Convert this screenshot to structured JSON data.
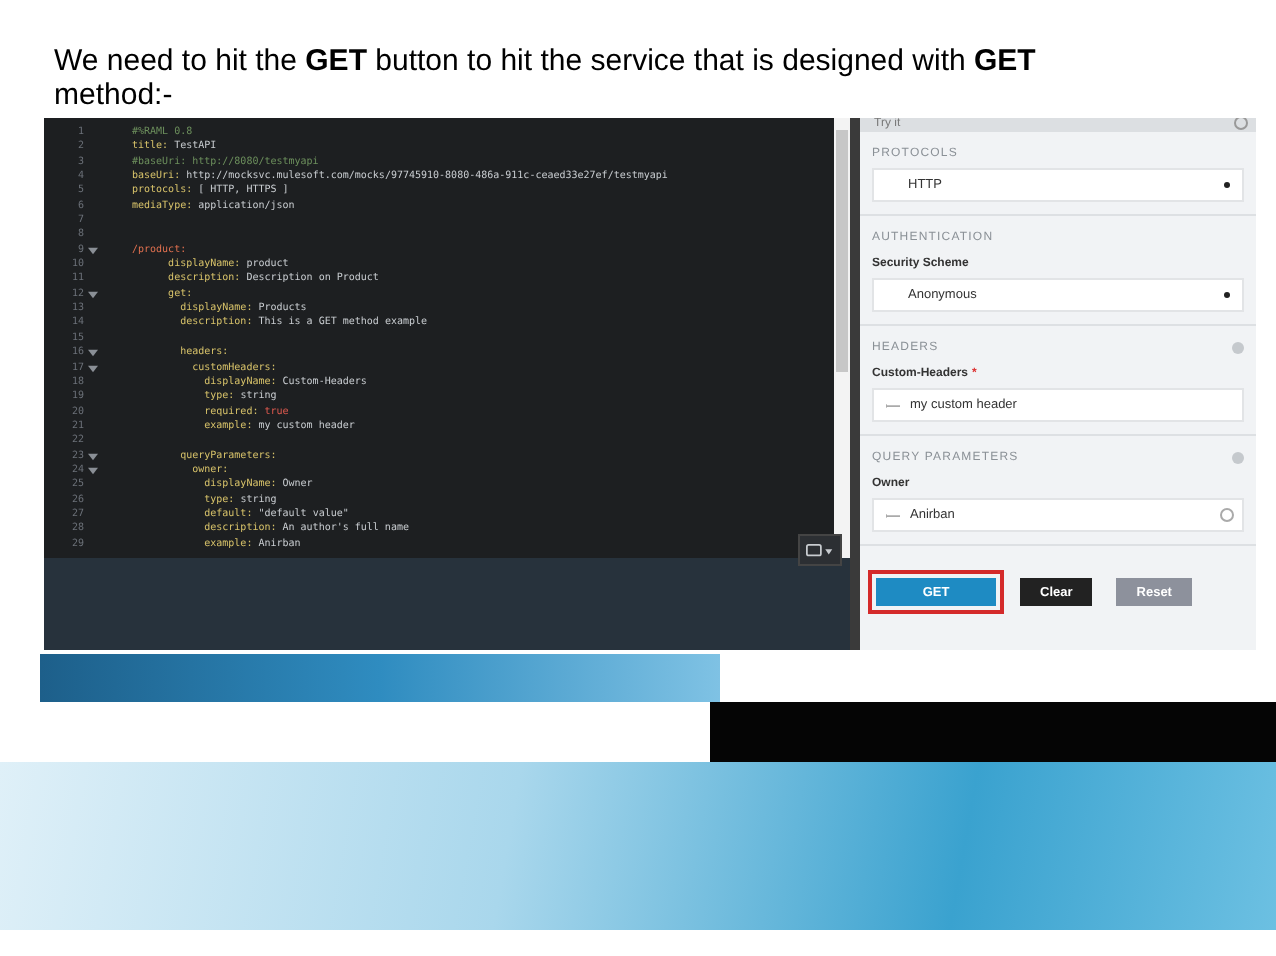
{
  "slide": {
    "heading": "We need to hit the **GET** button to hit the service that is designed with **GET** method:-"
  },
  "editor": {
    "lines": [
      {
        "number": "1",
        "kind": "comment",
        "key": "#%RAML 0.8",
        "foldable": false
      },
      {
        "number": "2",
        "kind": "pair",
        "key": "title:",
        "value": " TestAPI",
        "foldable": false
      },
      {
        "number": "3",
        "kind": "comment",
        "key": "#baseUri: http://8080/testmyapi",
        "foldable": false
      },
      {
        "number": "4",
        "kind": "pair",
        "key": "baseUri:",
        "value": " http://mocksvc.mulesoft.com/mocks/97745910-8080-486a-911c-ceaed33e27ef/testmyapi",
        "foldable": false
      },
      {
        "number": "5",
        "kind": "pair",
        "key": "protocols:",
        "value": " [ HTTP, HTTPS ]",
        "foldable": false
      },
      {
        "number": "6",
        "kind": "pair",
        "key": "mediaType:",
        "value": " application/json",
        "foldable": false
      },
      {
        "number": "7",
        "kind": "blank",
        "foldable": false
      },
      {
        "number": "8",
        "kind": "blank",
        "foldable": false
      },
      {
        "number": "9",
        "kind": "resource",
        "key": "/product:",
        "foldable": true
      },
      {
        "number": "10",
        "kind": "pair",
        "key": "      displayName:",
        "value": " product",
        "foldable": false
      },
      {
        "number": "11",
        "kind": "pair",
        "key": "      description:",
        "value": " Description on Product",
        "foldable": false
      },
      {
        "number": "12",
        "kind": "pair",
        "key": "      get:",
        "foldable": true
      },
      {
        "number": "13",
        "kind": "pair",
        "key": "        displayName:",
        "value": " Products",
        "foldable": false
      },
      {
        "number": "14",
        "kind": "pair",
        "key": "        description:",
        "value": " This is a GET method example",
        "foldable": false
      },
      {
        "number": "15",
        "kind": "blank",
        "foldable": false
      },
      {
        "number": "16",
        "kind": "pair",
        "key": "        headers:",
        "foldable": true
      },
      {
        "number": "17",
        "kind": "pair",
        "key": "          customHeaders:",
        "foldable": true
      },
      {
        "number": "18",
        "kind": "pair",
        "key": "            displayName:",
        "value": " Custom-Headers",
        "foldable": false
      },
      {
        "number": "19",
        "kind": "pair",
        "key": "            type:",
        "value": " string",
        "foldable": false
      },
      {
        "number": "20",
        "kind": "flag",
        "key": "            required:",
        "value": " true",
        "foldable": false
      },
      {
        "number": "21",
        "kind": "pair",
        "key": "            example:",
        "value": " my custom header",
        "foldable": false
      },
      {
        "number": "22",
        "kind": "blank",
        "foldable": false
      },
      {
        "number": "23",
        "kind": "pair",
        "key": "        queryParameters:",
        "foldable": true
      },
      {
        "number": "24",
        "kind": "pair",
        "key": "          owner:",
        "foldable": true
      },
      {
        "number": "25",
        "kind": "pair",
        "key": "            displayName:",
        "value": " Owner",
        "foldable": false
      },
      {
        "number": "26",
        "kind": "pair",
        "key": "            type:",
        "value": " string",
        "foldable": false
      },
      {
        "number": "27",
        "kind": "pair",
        "key": "            default:",
        "value": " \"default value\"",
        "foldable": false
      },
      {
        "number": "28",
        "kind": "pair",
        "key": "            description:",
        "value": " An author's full name",
        "foldable": false
      },
      {
        "number": "29",
        "kind": "pair",
        "key": "            example:",
        "value": " Anirban",
        "foldable": false
      }
    ]
  },
  "try_it": {
    "title": "Try it",
    "sections": [
      {
        "heading": "PROTOCOLS",
        "addable": false,
        "fields": [
          {
            "kind": "select",
            "value": "HTTP"
          }
        ]
      },
      {
        "heading": "AUTHENTICATION",
        "addable": false,
        "fields": [
          {
            "kind": "select",
            "label": "Security Scheme",
            "value": "Anonymous"
          }
        ]
      },
      {
        "heading": "HEADERS",
        "addable": true,
        "fields": [
          {
            "kind": "input",
            "label": "Custom-Headers",
            "required_mark": "*",
            "value": "my custom header",
            "info": false
          }
        ]
      },
      {
        "heading": "QUERY PARAMETERS",
        "addable": true,
        "fields": [
          {
            "kind": "input",
            "label": "Owner",
            "value": "Anirban",
            "info": true
          }
        ]
      }
    ],
    "buttons": [
      {
        "label": "GET",
        "kind": "primary",
        "highlighted": true
      },
      {
        "label": "Clear",
        "kind": "dark",
        "highlighted": false
      },
      {
        "label": "Reset",
        "kind": "muted",
        "highlighted": false
      }
    ]
  }
}
